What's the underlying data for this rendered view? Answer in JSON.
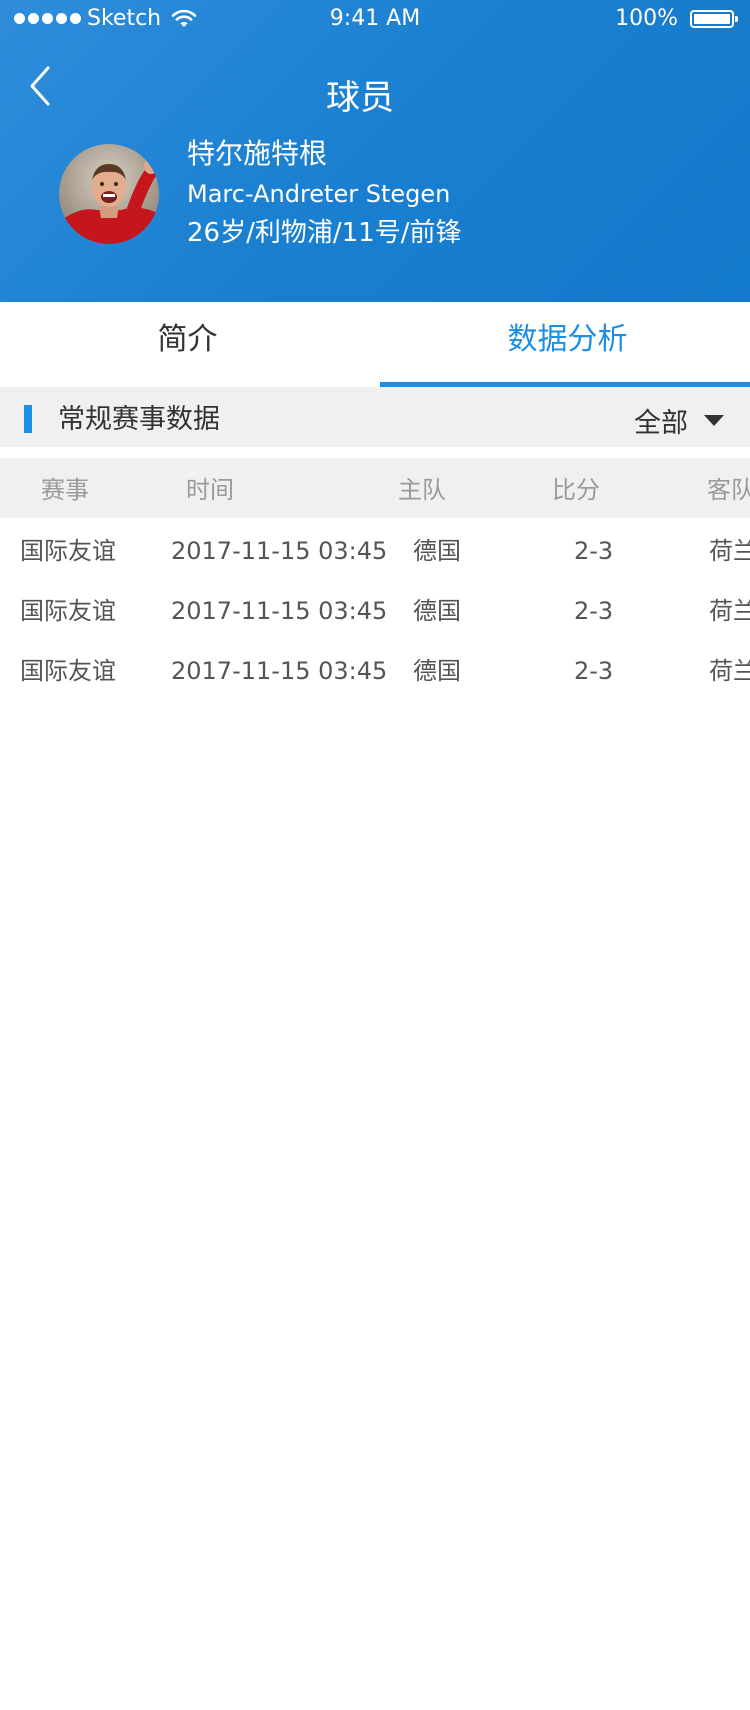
{
  "status_bar": {
    "carrier": "Sketch",
    "time": "9:41 AM",
    "battery": "100%"
  },
  "nav": {
    "title": "球员"
  },
  "player": {
    "name_cn": "特尔施特根",
    "name_en": "Marc-Andreter Stegen",
    "meta": "26岁/利物浦/11号/前锋"
  },
  "tabs": [
    {
      "label": "简介",
      "active": false
    },
    {
      "label": "数据分析",
      "active": true
    }
  ],
  "section": {
    "title": "常规赛事数据",
    "filter": "全部"
  },
  "table": {
    "headers": [
      "赛事",
      "时间",
      "主队",
      "比分",
      "客队"
    ],
    "rows": [
      {
        "event": "国际友谊",
        "time": "2017-11-15 03:45",
        "home": "德国",
        "score": "2-3",
        "away": "荷兰"
      },
      {
        "event": "国际友谊",
        "time": "2017-11-15 03:45",
        "home": "德国",
        "score": "2-3",
        "away": "荷兰"
      },
      {
        "event": "国际友谊",
        "time": "2017-11-15 03:45",
        "home": "德国",
        "score": "2-3",
        "away": "荷兰"
      }
    ]
  },
  "colors": {
    "header_blue": "#1a7fd0",
    "accent": "#1b8fe6",
    "section_bg": "#f0f0f0"
  }
}
